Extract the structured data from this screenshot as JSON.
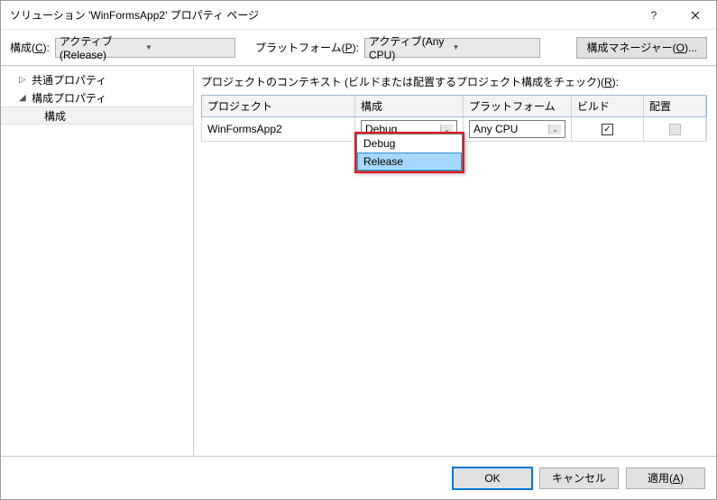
{
  "titlebar": {
    "title": "ソリューション 'WinFormsApp2' プロパティ ページ"
  },
  "toolbar": {
    "config_label": "構成(C):",
    "config_value": "アクティブ(Release)",
    "platform_label": "プラットフォーム(P):",
    "platform_value": "アクティブ(Any CPU)",
    "manager_label": "構成マネージャー(O)..."
  },
  "tree": {
    "item1": "共通プロパティ",
    "item2": "構成プロパティ",
    "sub": "構成"
  },
  "right": {
    "context_label": "プロジェクトのコンテキスト (ビルドまたは配置するプロジェクト構成をチェック)(R):",
    "headers": {
      "project": "プロジェクト",
      "config": "構成",
      "platform": "プラットフォーム",
      "build": "ビルド",
      "deploy": "配置"
    },
    "row": {
      "project": "WinFormsApp2",
      "config": "Debug",
      "platform": "Any CPU",
      "build_checked": true
    }
  },
  "dropdown": {
    "opt1": "Debug",
    "opt2": "Release"
  },
  "footer": {
    "ok": "OK",
    "cancel": "キャンセル",
    "apply": "適用(A)"
  }
}
